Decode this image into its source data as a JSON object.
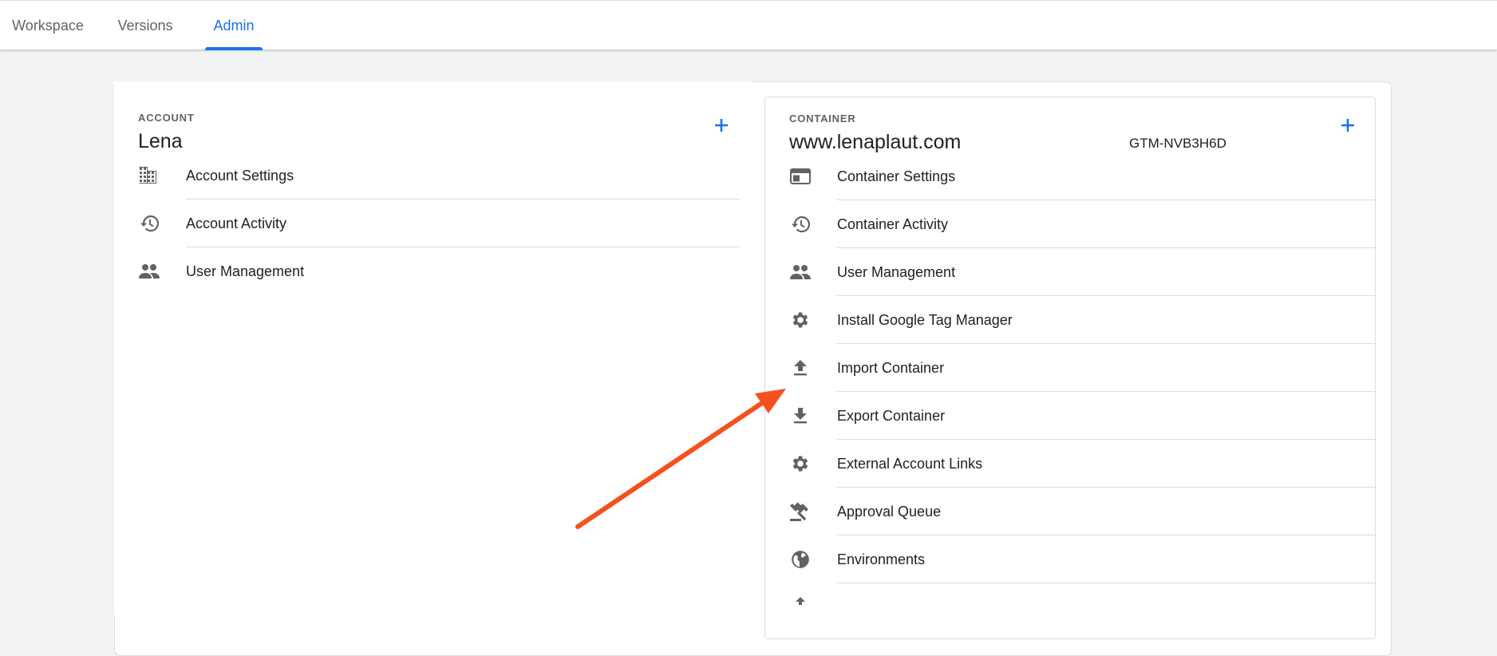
{
  "tabs": [
    {
      "label": "Workspace",
      "active": false
    },
    {
      "label": "Versions",
      "active": false
    },
    {
      "label": "Admin",
      "active": true
    }
  ],
  "account": {
    "section_label": "ACCOUNT",
    "name": "Lena",
    "items": [
      {
        "label": "Account Settings",
        "icon": "building-icon"
      },
      {
        "label": "Account Activity",
        "icon": "history-icon"
      },
      {
        "label": "User Management",
        "icon": "people-icon"
      }
    ]
  },
  "container": {
    "section_label": "CONTAINER",
    "name": "www.lenaplaut.com",
    "public_id": "GTM-NVB3H6D",
    "items": [
      {
        "label": "Container Settings",
        "icon": "web-window-icon"
      },
      {
        "label": "Container Activity",
        "icon": "history-icon"
      },
      {
        "label": "User Management",
        "icon": "people-icon"
      },
      {
        "label": "Install Google Tag Manager",
        "icon": "gear-icon"
      },
      {
        "label": "Import Container",
        "icon": "upload-icon"
      },
      {
        "label": "Export Container",
        "icon": "download-icon"
      },
      {
        "label": "External Account Links",
        "icon": "gear-icon"
      },
      {
        "label": "Approval Queue",
        "icon": "gavel-icon"
      },
      {
        "label": "Environments",
        "icon": "globe-icon"
      }
    ]
  },
  "colors": {
    "accent": "#1a73e8",
    "annotation_arrow": "#f4511e",
    "icon_gray": "#5f6368"
  }
}
